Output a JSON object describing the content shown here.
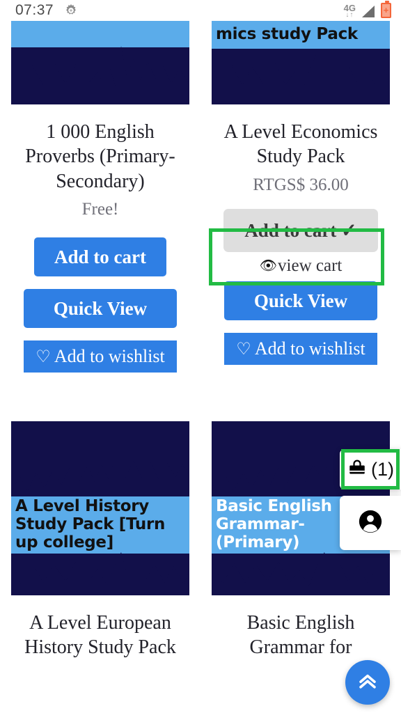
{
  "status_bar": {
    "time": "07:37",
    "gear_icon": "gear-icon",
    "network_label": "4G",
    "network_arrows": "↓↑",
    "signal_icon": "signal-triangle-icon",
    "battery_icon": "battery-charging-icon"
  },
  "products": [
    {
      "thumb_caption": "",
      "caption_style": "none",
      "title": "1 000 English Proverbs (Primary-Secondary)",
      "price": "Free!",
      "add_to_cart": "Add to cart",
      "quick_view": "Quick View",
      "wishlist": "Add to wishlist",
      "wishlist_icon": "♡",
      "in_cart": false
    },
    {
      "thumb_caption": "mics study Pack",
      "caption_style": "dark",
      "title": "A Level Economics Study Pack",
      "price": "RTGS$ 36.00",
      "add_to_cart": "Add to cart",
      "added_check": "✓",
      "view_cart": "view cart",
      "view_cart_icon": "👁",
      "quick_view": "Quick View",
      "wishlist": "Add to wishlist",
      "wishlist_icon": "♡",
      "in_cart": true
    },
    {
      "thumb_caption": "A Level History Study Pack [Turn up college]",
      "caption_style": "dark",
      "title": "A Level European History Study Pack",
      "price": "",
      "in_cart": false
    },
    {
      "thumb_caption": "Basic English Grammar-(Primary)",
      "caption_style": "light",
      "title": "Basic English Grammar for",
      "price": "",
      "in_cart": false
    }
  ],
  "cart_widget": {
    "icon": "shopping-bag-icon",
    "count_label": "(1)"
  },
  "account_widget": {
    "icon": "account-circle-icon"
  },
  "scroll_top_button": {
    "icon": "double-chevron-up-icon"
  },
  "colors": {
    "primary_blue": "#2f7fe4",
    "band_blue": "#5bacea",
    "navy": "#12104a",
    "highlight_green": "#22bb44",
    "added_gray": "#dedede"
  }
}
